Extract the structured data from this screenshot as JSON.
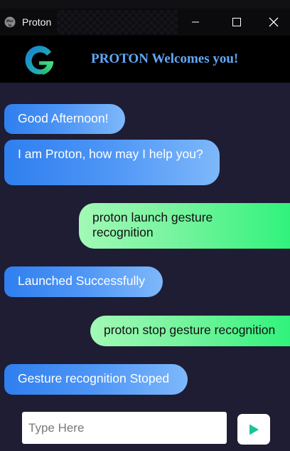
{
  "window": {
    "title": "Proton",
    "app_icon": "globe-icon",
    "controls": [
      "minimize-icon",
      "maximize-icon",
      "close-icon"
    ]
  },
  "header": {
    "logo_icon": "proton-logo",
    "welcome_text": "PROTON Welcomes you!",
    "welcome_color": "#61a8f8"
  },
  "chat": {
    "messages": [
      {
        "sender": "bot",
        "text": "Good Afternoon!"
      },
      {
        "sender": "bot",
        "text": "I am Proton, how may I help you?"
      },
      {
        "sender": "user",
        "text": "proton launch gesture recognition"
      },
      {
        "sender": "bot",
        "text": "Launched Successfully"
      },
      {
        "sender": "user",
        "text": "proton stop gesture recognition"
      },
      {
        "sender": "bot",
        "text": "Gesture recognition Stoped"
      }
    ]
  },
  "composer": {
    "placeholder": "Type Here",
    "value": "",
    "send_icon": "send-play-icon"
  },
  "colors": {
    "background": "#1e1d33",
    "bot_bubble": "#3b8af2",
    "user_bubble": "#5ef290",
    "send_icon": "#19c39a"
  }
}
